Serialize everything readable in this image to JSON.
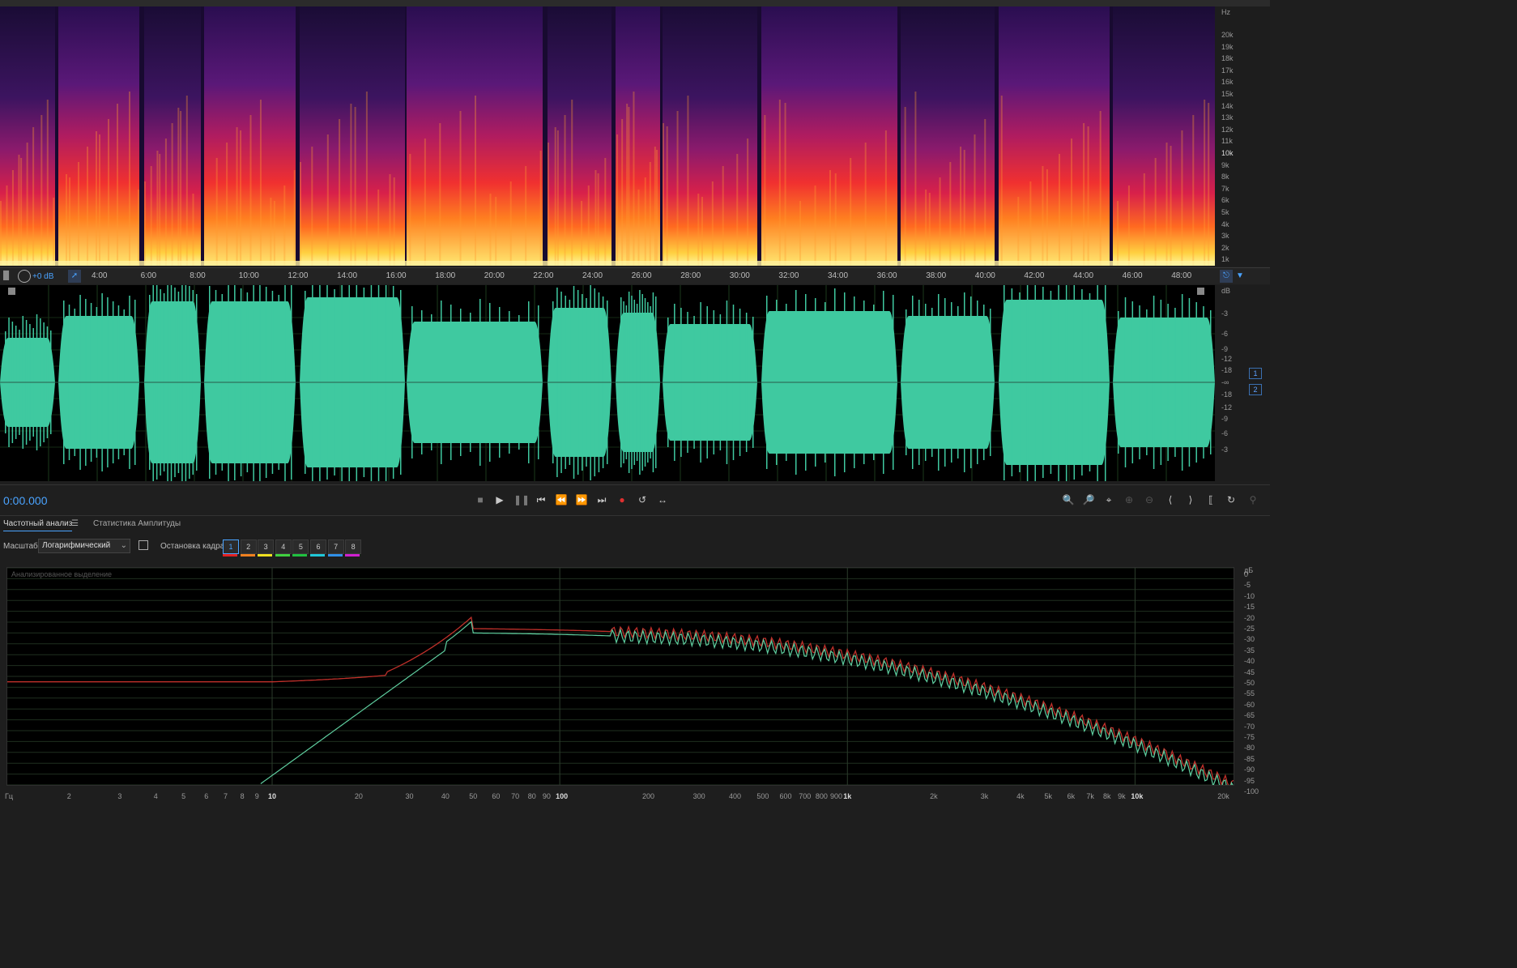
{
  "spectral": {
    "hz_unit": "Hz",
    "hz_ticks": [
      "20k",
      "19k",
      "18k",
      "17k",
      "16k",
      "15k",
      "14k",
      "13k",
      "12k",
      "11k",
      "10k",
      "9k",
      "8k",
      "7k",
      "6k",
      "5k",
      "4k",
      "3k",
      "2k",
      "1k"
    ]
  },
  "timeline": {
    "gain": "+0 dB",
    "ticks": [
      "4:00",
      "6:00",
      "8:00",
      "10:00",
      "12:00",
      "14:00",
      "16:00",
      "18:00",
      "20:00",
      "22:00",
      "24:00",
      "26:00",
      "28:00",
      "30:00",
      "32:00",
      "34:00",
      "36:00",
      "38:00",
      "40:00",
      "42:00",
      "44:00",
      "46:00",
      "48:00"
    ]
  },
  "waveform": {
    "db_unit": "dB",
    "db_ticks": [
      "-3",
      "-6",
      "-9",
      "-12",
      "-18",
      "-∞",
      "-18",
      "-12",
      "-9",
      "-6",
      "-3"
    ],
    "channels": [
      "1",
      "2"
    ]
  },
  "transport": {
    "timecode": "0:00.000"
  },
  "analysis": {
    "tab_frequency": "Частотный анализ",
    "tab_amplitude": "Статистика Амплитуды",
    "scale_label": "Масштаб:",
    "scale_value": "Логарифмический",
    "hold_label": "Остановка кадра:",
    "hold_buttons": [
      "1",
      "2",
      "3",
      "4",
      "5",
      "6",
      "7",
      "8"
    ],
    "hold_colors": [
      "#e02020",
      "#f08020",
      "#f0e020",
      "#40d040",
      "#20c040",
      "#20c8d8",
      "#3090e8",
      "#d020d0"
    ],
    "graph_title": "Анализированное выделение",
    "db_unit": "дБ",
    "db_ticks": [
      "0",
      "-5",
      "-10",
      "-15",
      "-20",
      "-25",
      "-30",
      "-35",
      "-40",
      "-45",
      "-50",
      "-55",
      "-60",
      "-65",
      "-70",
      "-75",
      "-80",
      "-85",
      "-90",
      "-95",
      "-100"
    ],
    "hz_unit": "Гц",
    "hz_ticks": [
      "2",
      "3",
      "4",
      "5",
      "6",
      "7",
      "8",
      "9",
      "10",
      "20",
      "30",
      "40",
      "50",
      "60",
      "70",
      "80",
      "90",
      "100",
      "200",
      "300",
      "400",
      "500",
      "600",
      "700",
      "800",
      "900",
      "1k",
      "2k",
      "3k",
      "4k",
      "5k",
      "6k",
      "7k",
      "8k",
      "9k",
      "10k",
      "20k"
    ],
    "series_colors": {
      "red": "#c0302a",
      "green": "#5fcfa0"
    }
  }
}
